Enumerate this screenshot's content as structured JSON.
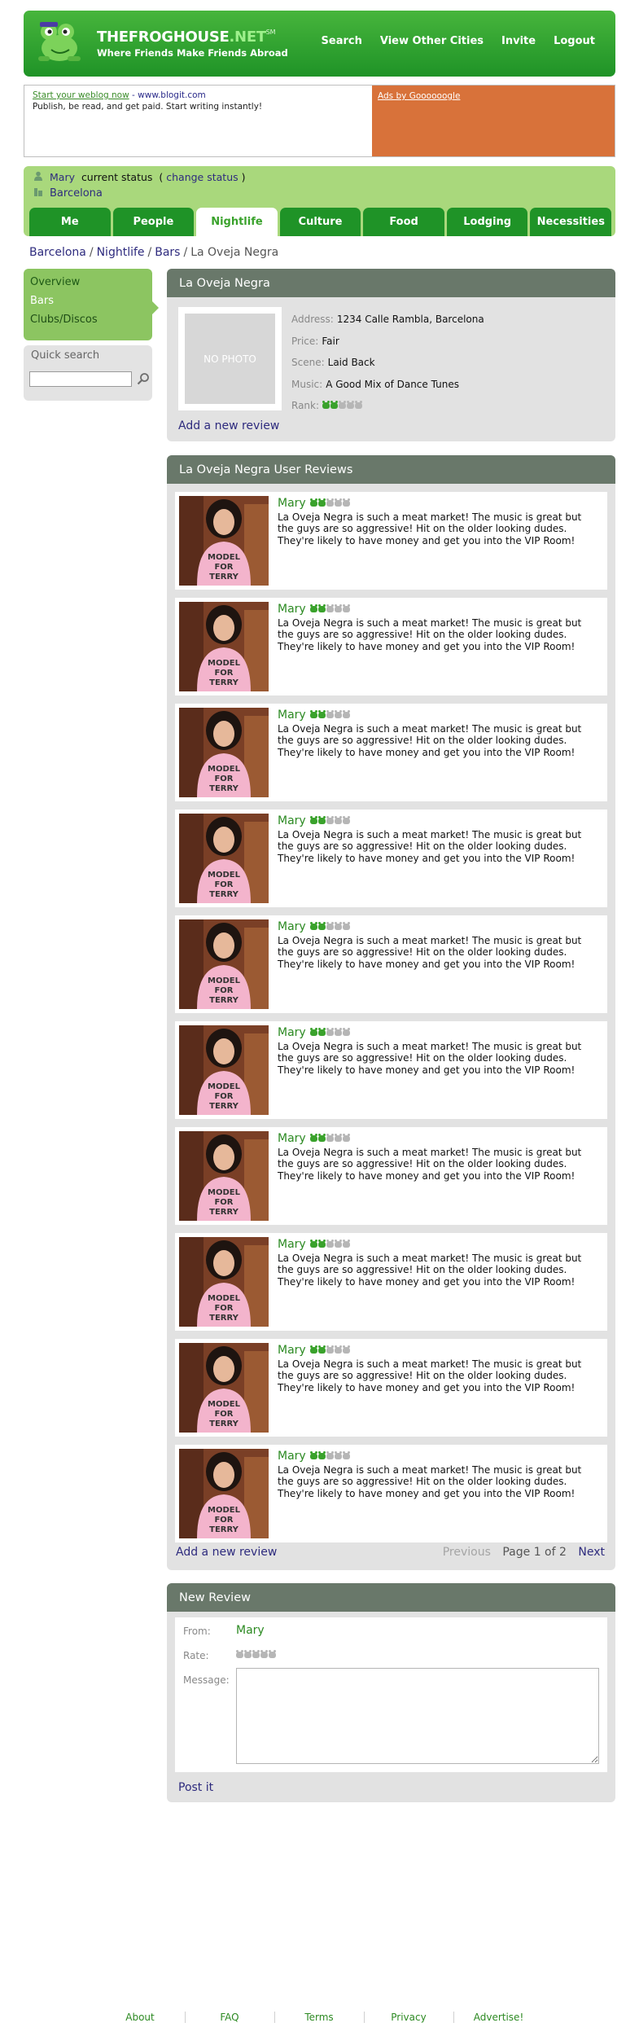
{
  "header": {
    "site_name_main": "THEFROGHOUSE",
    "site_name_dot": ".NET",
    "site_name_sup": "SM",
    "tagline": "Where Friends Make Friends Abroad",
    "nav": [
      "Search",
      "View Other Cities",
      "Invite",
      "Logout"
    ]
  },
  "ad": {
    "link": "Start your weblog now",
    "separator": " - ",
    "url": "www.blogit.com",
    "text": "Publish, be read, and get paid. Start writing instantly!",
    "ads_by": "Ads by Goooooogle"
  },
  "status": {
    "user": "Mary",
    "current_status_label": "current status",
    "open_paren": "(",
    "change_status": "change status",
    "close_paren": ")",
    "city": "Barcelona"
  },
  "tabs": [
    {
      "label": "Me",
      "active": false
    },
    {
      "label": "People",
      "active": false
    },
    {
      "label": "Nightlife",
      "active": true
    },
    {
      "label": "Culture",
      "active": false
    },
    {
      "label": "Food",
      "active": false
    },
    {
      "label": "Lodging",
      "active": false
    },
    {
      "label": "Necessities",
      "active": false
    }
  ],
  "breadcrumb": {
    "items": [
      "Barcelona",
      "Nightlife",
      "Bars"
    ],
    "current": "La Oveja Negra",
    "separator": "/"
  },
  "sidebar": {
    "items": [
      "Overview",
      "Bars",
      "Clubs/Discos"
    ],
    "quick_search_label": "Quick search"
  },
  "venue": {
    "title": "La Oveja Negra",
    "no_photo": "NO PHOTO",
    "address_label": "Address:",
    "address": "1234 Calle Rambla, Barcelona",
    "price_label": "Price:",
    "price": "Fair",
    "scene_label": "Scene:",
    "scene": "Laid Back",
    "music_label": "Music:",
    "music": "A Good Mix of Dance Tunes",
    "rank_label": "Rank:",
    "rank": 2,
    "rank_max": 5,
    "add_review": "Add a new review"
  },
  "reviews": {
    "title": "La Oveja Negra User Reviews",
    "items": [
      {
        "name": "Mary",
        "rating": 2,
        "text": "La Oveja Negra is such a meat market! The music is great but the guys are so aggressive! Hit on the older looking dudes. They're likely to have money and get you into the VIP Room!"
      },
      {
        "name": "Mary",
        "rating": 2,
        "text": "La Oveja Negra is such a meat market! The music is great but the guys are so aggressive! Hit on the older looking dudes. They're likely to have money and get you into the VIP Room!"
      },
      {
        "name": "Mary",
        "rating": 2,
        "text": "La Oveja Negra is such a meat market! The music is great but the guys are so aggressive! Hit on the older looking dudes. They're likely to have money and get you into the VIP Room!"
      },
      {
        "name": "Mary",
        "rating": 2,
        "text": "La Oveja Negra is such a meat market! The music is great but the guys are so aggressive! Hit on the older looking dudes. They're likely to have money and get you into the VIP Room!"
      },
      {
        "name": "Mary",
        "rating": 2,
        "text": "La Oveja Negra is such a meat market! The music is great but the guys are so aggressive! Hit on the older looking dudes. They're likely to have money and get you into the VIP Room!"
      },
      {
        "name": "Mary",
        "rating": 2,
        "text": "La Oveja Negra is such a meat market! The music is great but the guys are so aggressive! Hit on the older looking dudes. They're likely to have money and get you into the VIP Room!"
      },
      {
        "name": "Mary",
        "rating": 2,
        "text": "La Oveja Negra is such a meat market! The music is great but the guys are so aggressive! Hit on the older looking dudes. They're likely to have money and get you into the VIP Room!"
      },
      {
        "name": "Mary",
        "rating": 2,
        "text": "La Oveja Negra is such a meat market! The music is great but the guys are so aggressive! Hit on the older looking dudes. They're likely to have money and get you into the VIP Room!"
      },
      {
        "name": "Mary",
        "rating": 2,
        "text": "La Oveja Negra is such a meat market! The music is great but the guys are so aggressive! Hit on the older looking dudes. They're likely to have money and get you into the VIP Room!"
      },
      {
        "name": "Mary",
        "rating": 2,
        "text": "La Oveja Negra is such a meat market! The music is great but the guys are so aggressive! Hit on the older looking dudes. They're likely to have money and get you into the VIP Room!"
      }
    ],
    "add_review": "Add a new review",
    "pager": {
      "previous": "Previous",
      "info": "Page 1 of 2",
      "next": "Next"
    }
  },
  "new_review": {
    "title": "New Review",
    "from_label": "From:",
    "from": "Mary",
    "rate_label": "Rate:",
    "rate_max": 5,
    "message_label": "Message:",
    "post": "Post it"
  },
  "footer": [
    "About",
    "FAQ",
    "Terms",
    "Privacy",
    "Advertise!"
  ],
  "colors": {
    "brand_green": "#1f9327",
    "light_green": "#a9d87c",
    "panel_header": "#69786a",
    "link_blue": "#2e2b7e",
    "ad_orange": "#d8723a"
  }
}
